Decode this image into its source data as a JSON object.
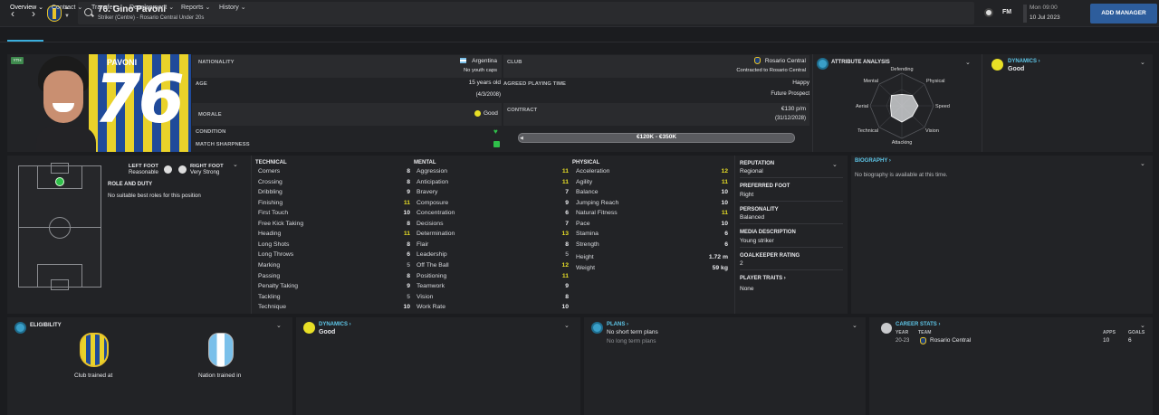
{
  "header": {
    "title": "76. Gino Pavoni",
    "subtitle": "Striker (Centre) - Rosario Central Under 20s",
    "date_line1": "Mon 09:00",
    "date_line2": "10 Jul 2023",
    "fm_label": "FM",
    "add_manager": "ADD MANAGER"
  },
  "tabs": [
    {
      "label": "Overview"
    },
    {
      "label": "Contract"
    },
    {
      "label": "Transfer"
    },
    {
      "label": "Development"
    },
    {
      "label": "Reports"
    },
    {
      "label": "History"
    }
  ],
  "profile": {
    "badge": "YTH",
    "shirt_name": "PAVONI",
    "shirt_number": "76",
    "nationality_label": "NATIONALITY",
    "nationality": "Argentina",
    "nationality_sub": "No youth caps",
    "age_label": "AGE",
    "age": "15 years old",
    "dob": "(4/3/2008)",
    "morale_label": "MORALE",
    "morale": "Good",
    "condition_label": "CONDITION",
    "sharpness_label": "MATCH SHARPNESS",
    "club_label": "CLUB",
    "club": "Rosario Central",
    "club_sub": "Contracted to Rosario Central",
    "playtime_label": "AGREED PLAYING TIME",
    "playtime": "Happy",
    "playtime_sub": "Future Prospect",
    "contract_label": "CONTRACT",
    "wage": "€130 p/m",
    "contract_end": "(31/12/2028)",
    "value_range": "€120K - €350K"
  },
  "attribute_analysis": {
    "title": "ATTRIBUTE ANALYSIS",
    "axes": [
      "Defending",
      "Physical",
      "Speed",
      "Vision",
      "Attacking",
      "Technical",
      "Aerial",
      "Mental"
    ],
    "levels": [
      0.35,
      0.45,
      0.5,
      0.45,
      0.5,
      0.45,
      0.35,
      0.45
    ]
  },
  "dynamics_top": {
    "title": "DYNAMICS",
    "value": "Good"
  },
  "feet": {
    "left_label": "LEFT FOOT",
    "left": "Reasonable",
    "right_label": "RIGHT FOOT",
    "right": "Very Strong"
  },
  "role": {
    "title": "ROLE AND DUTY",
    "text": "No suitable best roles for this position"
  },
  "technical": {
    "title": "TECHNICAL",
    "rows": [
      {
        "name": "Corners",
        "value": "8",
        "tone": "white"
      },
      {
        "name": "Crossing",
        "value": "8",
        "tone": "white"
      },
      {
        "name": "Dribbling",
        "value": "9",
        "tone": "white"
      },
      {
        "name": "Finishing",
        "value": "11",
        "tone": "yellow"
      },
      {
        "name": "First Touch",
        "value": "10",
        "tone": "white"
      },
      {
        "name": "Free Kick Taking",
        "value": "8",
        "tone": "white"
      },
      {
        "name": "Heading",
        "value": "11",
        "tone": "yellow"
      },
      {
        "name": "Long Shots",
        "value": "8",
        "tone": "white"
      },
      {
        "name": "Long Throws",
        "value": "6",
        "tone": "white"
      },
      {
        "name": "Marking",
        "value": "5",
        "tone": "grey"
      },
      {
        "name": "Passing",
        "value": "8",
        "tone": "white"
      },
      {
        "name": "Penalty Taking",
        "value": "9",
        "tone": "white"
      },
      {
        "name": "Tackling",
        "value": "5",
        "tone": "grey"
      },
      {
        "name": "Technique",
        "value": "10",
        "tone": "white"
      }
    ]
  },
  "mental": {
    "title": "MENTAL",
    "rows": [
      {
        "name": "Aggression",
        "value": "11",
        "tone": "yellow"
      },
      {
        "name": "Anticipation",
        "value": "11",
        "tone": "yellow"
      },
      {
        "name": "Bravery",
        "value": "7",
        "tone": "white"
      },
      {
        "name": "Composure",
        "value": "9",
        "tone": "white"
      },
      {
        "name": "Concentration",
        "value": "6",
        "tone": "white"
      },
      {
        "name": "Decisions",
        "value": "7",
        "tone": "white"
      },
      {
        "name": "Determination",
        "value": "13",
        "tone": "yellow"
      },
      {
        "name": "Flair",
        "value": "8",
        "tone": "white"
      },
      {
        "name": "Leadership",
        "value": "5",
        "tone": "grey"
      },
      {
        "name": "Off The Ball",
        "value": "12",
        "tone": "yellow"
      },
      {
        "name": "Positioning",
        "value": "11",
        "tone": "yellow"
      },
      {
        "name": "Teamwork",
        "value": "9",
        "tone": "white"
      },
      {
        "name": "Vision",
        "value": "8",
        "tone": "white"
      },
      {
        "name": "Work Rate",
        "value": "10",
        "tone": "white"
      }
    ]
  },
  "physical": {
    "title": "PHYSICAL",
    "rows": [
      {
        "name": "Acceleration",
        "value": "12",
        "tone": "yellow"
      },
      {
        "name": "Agility",
        "value": "11",
        "tone": "yellow"
      },
      {
        "name": "Balance",
        "value": "10",
        "tone": "white"
      },
      {
        "name": "Jumping Reach",
        "value": "10",
        "tone": "white"
      },
      {
        "name": "Natural Fitness",
        "value": "11",
        "tone": "yellow"
      },
      {
        "name": "Pace",
        "value": "10",
        "tone": "white"
      },
      {
        "name": "Stamina",
        "value": "6",
        "tone": "white"
      },
      {
        "name": "Strength",
        "value": "6",
        "tone": "white"
      }
    ],
    "extra": [
      {
        "name": "Height",
        "value": "1.72 m"
      },
      {
        "name": "Weight",
        "value": "59 kg"
      }
    ]
  },
  "info": {
    "reputation_label": "REPUTATION",
    "reputation": "Regional",
    "foot_label": "PREFERRED FOOT",
    "foot": "Right",
    "personality_label": "PERSONALITY",
    "personality": "Balanced",
    "media_label": "MEDIA DESCRIPTION",
    "media": "Young striker",
    "gk_label": "GOALKEEPER RATING",
    "gk": "2",
    "traits_label": "PLAYER TRAITS",
    "traits": "None"
  },
  "biography": {
    "title": "BIOGRAPHY",
    "text": "No biography is available at this time."
  },
  "eligibility": {
    "title": "ELIGIBILITY",
    "club": "Club trained at",
    "nation": "Nation trained in"
  },
  "dynamics_bottom": {
    "title": "DYNAMICS",
    "value": "Good"
  },
  "plans": {
    "title": "PLANS",
    "short": "No short term plans",
    "long": "No long term plans"
  },
  "career": {
    "title": "CAREER STATS",
    "year_label": "YEAR",
    "team_label": "TEAM",
    "apps_label": "APPS",
    "goals_label": "GOALS",
    "year": "20-23",
    "team": "Rosario Central",
    "apps": "10",
    "goals": "6"
  },
  "colors": {
    "accent": "#5ec6e8",
    "highlight": "#e8df26",
    "brand": "#2d5d9c"
  }
}
